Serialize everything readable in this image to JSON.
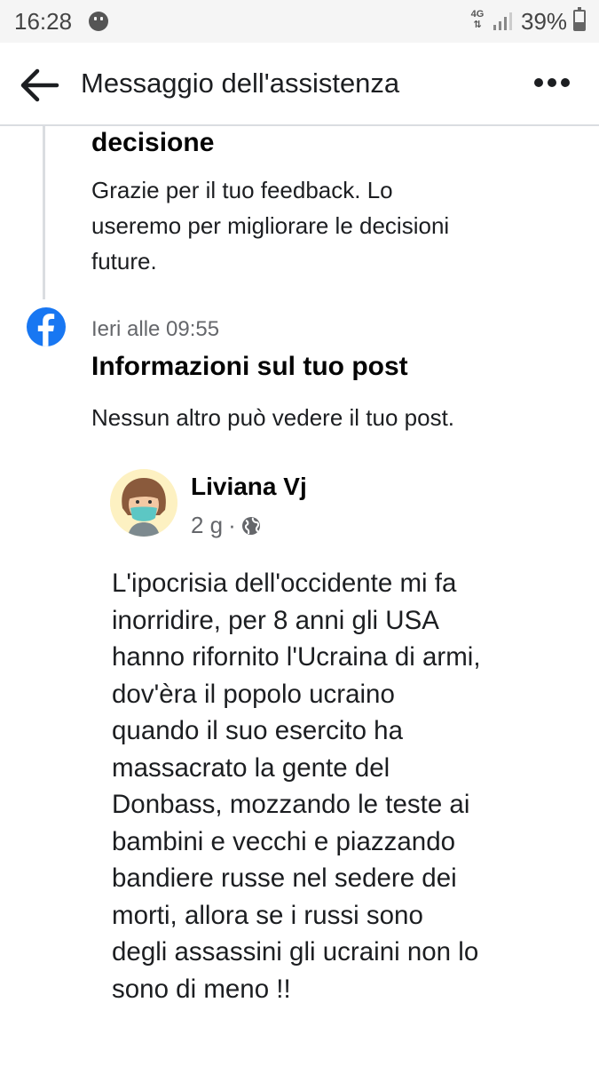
{
  "status_bar": {
    "time": "16:28",
    "network": "4G",
    "battery_text": "39%",
    "battery_level": 0.39,
    "icons": [
      "face-icon",
      "signal-icon",
      "battery-icon"
    ]
  },
  "header": {
    "title": "Messaggio dell'assistenza",
    "back_icon": "arrow-left-icon",
    "more_icon": "more-dots-icon"
  },
  "previous_message": {
    "heading_fragment": "decisione",
    "body": [
      "Grazie per il tuo feedback. Lo",
      "useremo per migliorare le decisioni",
      "future."
    ]
  },
  "message": {
    "icon": "facebook-icon",
    "timestamp": "Ieri alle 09:55",
    "title": "Informazioni sul tuo post",
    "body": "Nessun altro può vedere il tuo post."
  },
  "post": {
    "author": "Liviana Vj",
    "age": "2 g",
    "separator": "·",
    "privacy_icon": "globe-icon",
    "avatar_icon": "avatar-mask-icon",
    "text_lines": [
      "L'ipocrisia dell'occidente mi fa",
      "inorridire, per 8 anni gli USA",
      "hanno rifornito l'Ucraina di armi,",
      "dov'èra il popolo ucraino",
      "quando il suo esercito ha",
      "massacrato la gente del",
      "Donbass, mozzando le teste ai",
      "bambini e vecchi e piazzando",
      "bandiere russe nel sedere dei",
      "morti, allora se i russi sono",
      "degli assassini gli ucraini non lo",
      "sono di meno !!"
    ]
  },
  "colors": {
    "facebook_blue": "#1877f2",
    "meta_gray": "#65676b",
    "divider": "#dadde1"
  }
}
